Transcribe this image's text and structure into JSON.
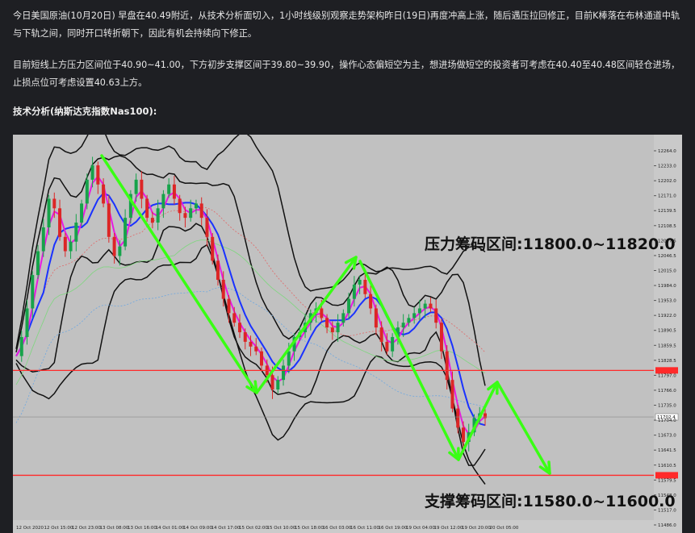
{
  "article": {
    "paragraph1": "今日美国原油(10月20日) 早盘在40.49附近，从技术分析面切入，1小时线级别观察走势架构昨日(19日)再度冲高上涨，随后遇压拉回修正，目前K棒落在布林通道中轨与下轨之间，同时开口转折朝下，因此有机会持续向下修正。",
    "paragraph2": "目前短线上方压力区间位于40.90~41.00，下方初步支撑区间于39.80~39.90，操作心态偏短空为主，想进场做短空的投资者可考虑在40.40至40.48区间轻仓进场，止损点位可考虑设置40.63上方。",
    "heading": "技术分析(纳斯达克指数Nas100):"
  },
  "chart_data": {
    "type": "candlestick",
    "title": "",
    "resistance_label": "压力筹码区间:11800.0~11820.0",
    "support_label": "支撑筹码区间:11580.0~11600.0",
    "y_ticks": [
      "12264.0",
      "12233.0",
      "12202.0",
      "12171.0",
      "12139.5",
      "12108.5",
      "12077.5",
      "12046.5",
      "12015.0",
      "11984.0",
      "11953.0",
      "11922.0",
      "11890.5",
      "11859.5",
      "11828.5",
      "11797.0",
      "11766.0",
      "11735.0",
      "11704.0",
      "11673.0",
      "11641.5",
      "11610.5",
      "11579.5",
      "11548.0",
      "11517.0",
      "11486.0"
    ],
    "ylim": [
      11486.0,
      12264.0
    ],
    "x_ticks": [
      "12 Oct 2020",
      "12 Oct 15:00",
      "12 Oct 23:00",
      "13 Oct 08:00",
      "13 Oct 16:00",
      "14 Oct 01:00",
      "14 Oct 09:00",
      "14 Oct 17:00",
      "15 Oct 02:00",
      "15 Oct 10:00",
      "15 Oct 18:00",
      "16 Oct 03:00",
      "16 Oct 11:00",
      "16 Oct 19:00",
      "19 Oct 04:00",
      "19 Oct 12:00",
      "19 Oct 20:00",
      "20 Oct 05:00"
    ],
    "resistance_level": 11800.0,
    "support_level": 11580.0,
    "current_price": "11702.4",
    "current_price_value": 11702.4,
    "price_path": [
      11830,
      11870,
      11930,
      12000,
      12050,
      12100,
      12160,
      12140,
      12080,
      12050,
      12070,
      12110,
      12150,
      12200,
      12230,
      12190,
      12150,
      12080,
      12040,
      12060,
      12120,
      12170,
      12200,
      12160,
      12120,
      12110,
      12140,
      12170,
      12190,
      12160,
      12130,
      12120,
      12140,
      12150,
      12120,
      12080,
      12030,
      11990,
      11950,
      11920,
      11900,
      11880,
      11860,
      11850,
      11840,
      11810,
      11790,
      11760,
      11780,
      11810,
      11840,
      11870,
      11880,
      11900,
      11920,
      11930,
      11910,
      11890,
      11880,
      11900,
      11920,
      11950,
      11980,
      11990,
      11960,
      11930,
      11890,
      11860,
      11840,
      11870,
      11890,
      11900,
      11910,
      11920,
      11930,
      11940,
      11930,
      11900,
      11840,
      11780,
      11720,
      11680,
      11650,
      11670,
      11700,
      11710,
      11700
    ],
    "colors": {
      "up": "#16a34a",
      "down": "#dc2626",
      "resistance": "#ff2a2a",
      "arrow": "#39ff14",
      "ma_fast": "#e81ae0",
      "ma_mid": "#1a32ff",
      "bollinger": "#111111"
    }
  }
}
